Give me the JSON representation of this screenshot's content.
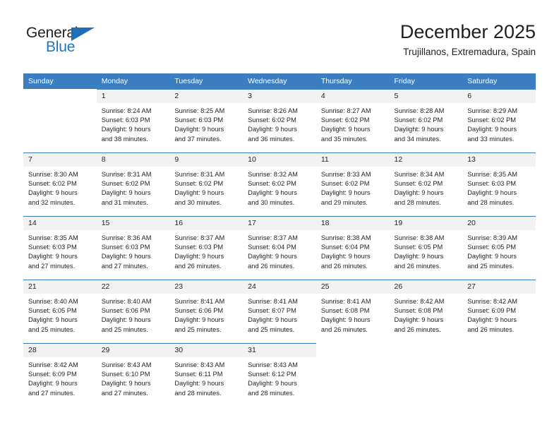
{
  "logo": {
    "word_one": "General",
    "word_two": "Blue",
    "triangle_color": "#1c6fb8",
    "blue_color": "#2175c4"
  },
  "header": {
    "title": "December 2025",
    "subtitle": "Trujillanos, Extremadura, Spain"
  },
  "theme": {
    "header_bg": "#3c7fc1",
    "daynum_bg": "#f2f2f2",
    "text": "#231f20"
  },
  "weekdays": [
    "Sunday",
    "Monday",
    "Tuesday",
    "Wednesday",
    "Thursday",
    "Friday",
    "Saturday"
  ],
  "weeks": [
    [
      {
        "day": "",
        "lines": []
      },
      {
        "day": "1",
        "lines": [
          "Sunrise: 8:24 AM",
          "Sunset: 6:03 PM",
          "Daylight: 9 hours",
          "and 38 minutes."
        ]
      },
      {
        "day": "2",
        "lines": [
          "Sunrise: 8:25 AM",
          "Sunset: 6:03 PM",
          "Daylight: 9 hours",
          "and 37 minutes."
        ]
      },
      {
        "day": "3",
        "lines": [
          "Sunrise: 8:26 AM",
          "Sunset: 6:02 PM",
          "Daylight: 9 hours",
          "and 36 minutes."
        ]
      },
      {
        "day": "4",
        "lines": [
          "Sunrise: 8:27 AM",
          "Sunset: 6:02 PM",
          "Daylight: 9 hours",
          "and 35 minutes."
        ]
      },
      {
        "day": "5",
        "lines": [
          "Sunrise: 8:28 AM",
          "Sunset: 6:02 PM",
          "Daylight: 9 hours",
          "and 34 minutes."
        ]
      },
      {
        "day": "6",
        "lines": [
          "Sunrise: 8:29 AM",
          "Sunset: 6:02 PM",
          "Daylight: 9 hours",
          "and 33 minutes."
        ]
      }
    ],
    [
      {
        "day": "7",
        "lines": [
          "Sunrise: 8:30 AM",
          "Sunset: 6:02 PM",
          "Daylight: 9 hours",
          "and 32 minutes."
        ]
      },
      {
        "day": "8",
        "lines": [
          "Sunrise: 8:31 AM",
          "Sunset: 6:02 PM",
          "Daylight: 9 hours",
          "and 31 minutes."
        ]
      },
      {
        "day": "9",
        "lines": [
          "Sunrise: 8:31 AM",
          "Sunset: 6:02 PM",
          "Daylight: 9 hours",
          "and 30 minutes."
        ]
      },
      {
        "day": "10",
        "lines": [
          "Sunrise: 8:32 AM",
          "Sunset: 6:02 PM",
          "Daylight: 9 hours",
          "and 30 minutes."
        ]
      },
      {
        "day": "11",
        "lines": [
          "Sunrise: 8:33 AM",
          "Sunset: 6:02 PM",
          "Daylight: 9 hours",
          "and 29 minutes."
        ]
      },
      {
        "day": "12",
        "lines": [
          "Sunrise: 8:34 AM",
          "Sunset: 6:02 PM",
          "Daylight: 9 hours",
          "and 28 minutes."
        ]
      },
      {
        "day": "13",
        "lines": [
          "Sunrise: 8:35 AM",
          "Sunset: 6:03 PM",
          "Daylight: 9 hours",
          "and 28 minutes."
        ]
      }
    ],
    [
      {
        "day": "14",
        "lines": [
          "Sunrise: 8:35 AM",
          "Sunset: 6:03 PM",
          "Daylight: 9 hours",
          "and 27 minutes."
        ]
      },
      {
        "day": "15",
        "lines": [
          "Sunrise: 8:36 AM",
          "Sunset: 6:03 PM",
          "Daylight: 9 hours",
          "and 27 minutes."
        ]
      },
      {
        "day": "16",
        "lines": [
          "Sunrise: 8:37 AM",
          "Sunset: 6:03 PM",
          "Daylight: 9 hours",
          "and 26 minutes."
        ]
      },
      {
        "day": "17",
        "lines": [
          "Sunrise: 8:37 AM",
          "Sunset: 6:04 PM",
          "Daylight: 9 hours",
          "and 26 minutes."
        ]
      },
      {
        "day": "18",
        "lines": [
          "Sunrise: 8:38 AM",
          "Sunset: 6:04 PM",
          "Daylight: 9 hours",
          "and 26 minutes."
        ]
      },
      {
        "day": "19",
        "lines": [
          "Sunrise: 8:38 AM",
          "Sunset: 6:05 PM",
          "Daylight: 9 hours",
          "and 26 minutes."
        ]
      },
      {
        "day": "20",
        "lines": [
          "Sunrise: 8:39 AM",
          "Sunset: 6:05 PM",
          "Daylight: 9 hours",
          "and 25 minutes."
        ]
      }
    ],
    [
      {
        "day": "21",
        "lines": [
          "Sunrise: 8:40 AM",
          "Sunset: 6:05 PM",
          "Daylight: 9 hours",
          "and 25 minutes."
        ]
      },
      {
        "day": "22",
        "lines": [
          "Sunrise: 8:40 AM",
          "Sunset: 6:06 PM",
          "Daylight: 9 hours",
          "and 25 minutes."
        ]
      },
      {
        "day": "23",
        "lines": [
          "Sunrise: 8:41 AM",
          "Sunset: 6:06 PM",
          "Daylight: 9 hours",
          "and 25 minutes."
        ]
      },
      {
        "day": "24",
        "lines": [
          "Sunrise: 8:41 AM",
          "Sunset: 6:07 PM",
          "Daylight: 9 hours",
          "and 25 minutes."
        ]
      },
      {
        "day": "25",
        "lines": [
          "Sunrise: 8:41 AM",
          "Sunset: 6:08 PM",
          "Daylight: 9 hours",
          "and 26 minutes."
        ]
      },
      {
        "day": "26",
        "lines": [
          "Sunrise: 8:42 AM",
          "Sunset: 6:08 PM",
          "Daylight: 9 hours",
          "and 26 minutes."
        ]
      },
      {
        "day": "27",
        "lines": [
          "Sunrise: 8:42 AM",
          "Sunset: 6:09 PM",
          "Daylight: 9 hours",
          "and 26 minutes."
        ]
      }
    ],
    [
      {
        "day": "28",
        "lines": [
          "Sunrise: 8:42 AM",
          "Sunset: 6:09 PM",
          "Daylight: 9 hours",
          "and 27 minutes."
        ]
      },
      {
        "day": "29",
        "lines": [
          "Sunrise: 8:43 AM",
          "Sunset: 6:10 PM",
          "Daylight: 9 hours",
          "and 27 minutes."
        ]
      },
      {
        "day": "30",
        "lines": [
          "Sunrise: 8:43 AM",
          "Sunset: 6:11 PM",
          "Daylight: 9 hours",
          "and 28 minutes."
        ]
      },
      {
        "day": "31",
        "lines": [
          "Sunrise: 8:43 AM",
          "Sunset: 6:12 PM",
          "Daylight: 9 hours",
          "and 28 minutes."
        ]
      },
      {
        "day": "",
        "lines": []
      },
      {
        "day": "",
        "lines": []
      },
      {
        "day": "",
        "lines": []
      }
    ]
  ]
}
